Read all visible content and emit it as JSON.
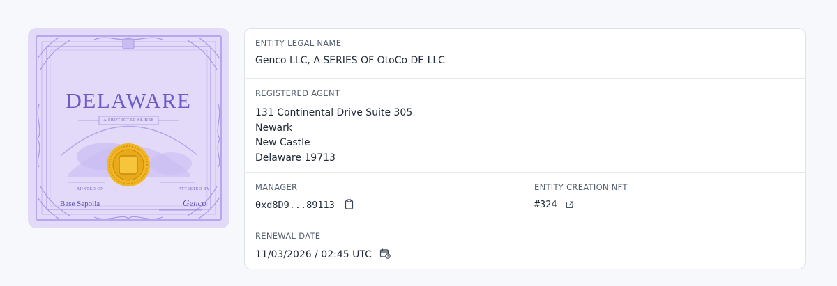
{
  "certificate": {
    "title": "DELAWARE",
    "subtitle": "A PROTECTED SERIES",
    "minted_label": "MINTED ON",
    "minted_value": "Base Sepolia",
    "attested_label": "ATTESTED BY",
    "signature": "Genco"
  },
  "details": {
    "legal_name": {
      "label": "ENTITY LEGAL NAME",
      "value": "Genco LLC, A SERIES OF OtoCo DE LLC"
    },
    "registered_agent": {
      "label": "REGISTERED AGENT",
      "lines": [
        "131 Continental Drive Suite 305",
        "Newark",
        "New Castle",
        "Delaware 19713"
      ]
    },
    "manager": {
      "label": "MANAGER",
      "value": "0xd8D9...89113",
      "icon": "clipboard-icon"
    },
    "creation_nft": {
      "label": "ENTITY CREATION NFT",
      "value": "#324",
      "icon": "external-link-icon"
    },
    "renewal_date": {
      "label": "RENEWAL DATE",
      "value": "11/03/2026 / 02:45 UTC",
      "icon": "calendar-icon"
    }
  },
  "colors": {
    "certificate_bg": "#e3daf9",
    "certificate_ink": "#6d5cc4",
    "seal_gold": "#e8a91a",
    "card_border": "#dfe3e8"
  }
}
